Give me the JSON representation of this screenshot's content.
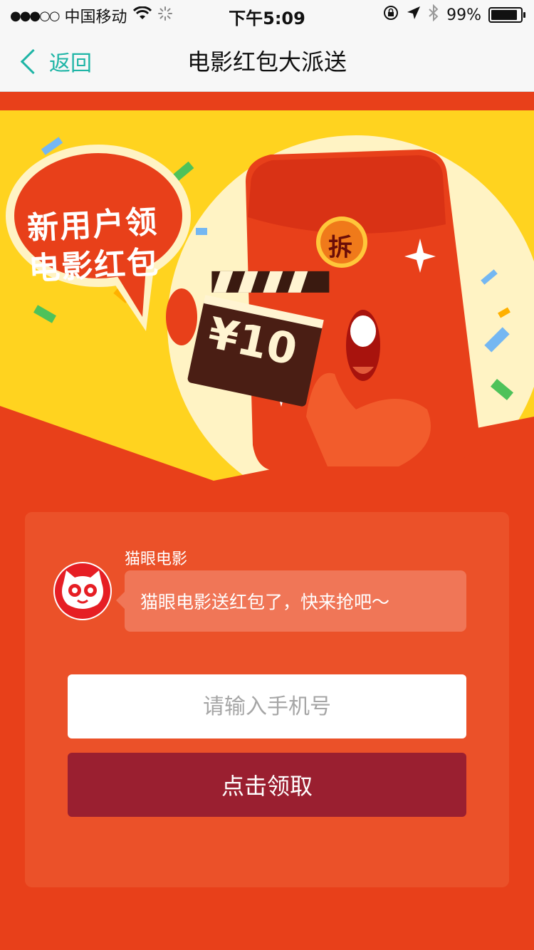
{
  "status_bar": {
    "signal_dots": "●●●○○",
    "carrier": "中国移动",
    "time": "下午5:09",
    "battery_percent": "99%",
    "icons": [
      "wifi-icon",
      "loading-icon",
      "rotation-lock-icon",
      "location-arrow-icon",
      "bluetooth-icon",
      "battery-icon"
    ]
  },
  "nav": {
    "back_label": "返回",
    "title": "电影红包大派送"
  },
  "banner": {
    "speech_line1": "新用户领",
    "speech_line2": "电影红包",
    "amount": "¥10",
    "open_char": "拆",
    "colors": {
      "background": "#ffd21f",
      "envelope": "#e8401a",
      "ticket": "#4a1e14"
    }
  },
  "card": {
    "sender_name": "猫眼电影",
    "message": "猫眼电影送红包了，快来抢吧～",
    "phone_placeholder": "请输入手机号",
    "claim_button_label": "点击领取"
  },
  "colors": {
    "accent": "#1fb5a6",
    "page_bg": "#e8401a",
    "card_bg": "#eb5129",
    "button": "#9a1f30"
  }
}
